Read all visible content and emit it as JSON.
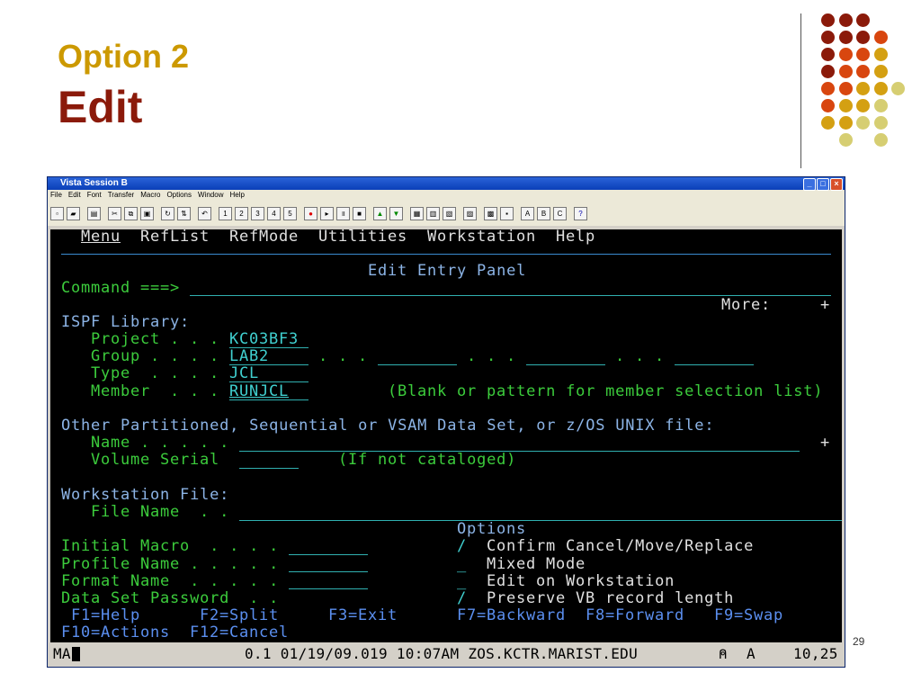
{
  "slide": {
    "subtitle": "Option 2",
    "title": "Edit",
    "page_number": "29"
  },
  "window": {
    "title": "Vista Session B",
    "menu": [
      "File",
      "Edit",
      "Font",
      "Transfer",
      "Macro",
      "Options",
      "Window",
      "Help"
    ],
    "toolbar_labels": [
      "1",
      "2",
      "3",
      "4",
      "5",
      "A",
      "B",
      "C",
      "?"
    ]
  },
  "ispf": {
    "menu": [
      "Menu",
      "RefList",
      "RefMode",
      "Utilities",
      "Workstation",
      "Help"
    ],
    "panel_title": "Edit Entry Panel",
    "command_label": "Command ===>",
    "more": "More:",
    "plus": "+",
    "library_heading": "ISPF Library:",
    "project_label": "Project . . .",
    "project": "KC03BF3",
    "group_label": "Group . . . .",
    "group": "LAB2",
    "group_dots": ". . .",
    "type_label": "Type  . . . .",
    "type": "JCL",
    "member_label": "Member  . . .",
    "member": "RUNJCL",
    "member_hint": "(Blank or pattern for member selection list)",
    "other_heading": "Other Partitioned, Sequential or VSAM Data Set, or z/OS UNIX file:",
    "name_label": "Name . . . . .",
    "volume_label": "Volume Serial",
    "volume_hint": "(If not cataloged)",
    "ws_heading": "Workstation File:",
    "filename_label": "File Name  . .",
    "options_heading": "Options",
    "initial_macro": "Initial Macro  . . . .",
    "profile_name": "Profile Name . . . . .",
    "format_name": "Format Name  . . . . .",
    "dsn_password": "Data Set Password  . .",
    "options": [
      {
        "mark": "/",
        "label": "Confirm Cancel/Move/Replace"
      },
      {
        "mark": "_",
        "label": "Mixed Mode"
      },
      {
        "mark": "_",
        "label": "Edit on Workstation"
      },
      {
        "mark": "/",
        "label": "Preserve VB record length"
      }
    ],
    "pf": [
      "F1=Help",
      "F2=Split",
      "F3=Exit",
      "F7=Backward",
      "F8=Forward",
      "F9=Swap",
      "F10=Actions",
      "F12=Cancel"
    ]
  },
  "status": {
    "mode": "MA",
    "info": "0.1 01/19/09.019 10:07AM ZOS.KCTR.MARIST.EDU",
    "lock": "A",
    "cursor": "10,25"
  }
}
